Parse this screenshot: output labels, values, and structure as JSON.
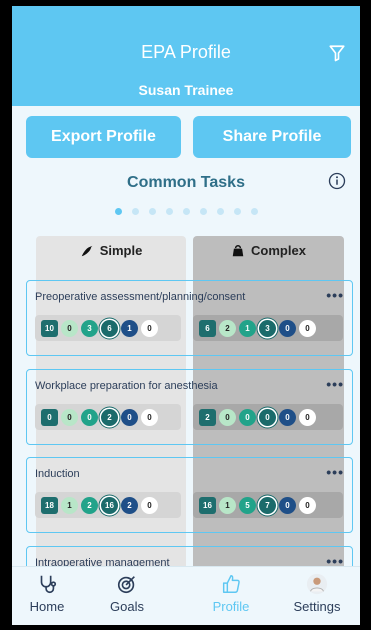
{
  "header": {
    "title": "EPA Profile",
    "user_name": "Susan Trainee"
  },
  "actions": {
    "export_label": "Export Profile",
    "share_label": "Share Profile"
  },
  "section_title": "Common Tasks",
  "pager": {
    "count": 9,
    "active_index": 0
  },
  "tabs": {
    "simple_label": "Simple",
    "complex_label": "Complex"
  },
  "cards": [
    {
      "title": "Preoperative assessment/planning/consent",
      "simple": [
        "10",
        "0",
        "3",
        "6",
        "1",
        "0"
      ],
      "complex": [
        "6",
        "2",
        "1",
        "3",
        "0",
        "0"
      ]
    },
    {
      "title": "Workplace preparation for anesthesia",
      "simple": [
        "0",
        "0",
        "0",
        "2",
        "0",
        "0"
      ],
      "complex": [
        "2",
        "0",
        "0",
        "0",
        "0",
        "0"
      ]
    },
    {
      "title": "Induction",
      "simple": [
        "18",
        "1",
        "2",
        "16",
        "2",
        "0"
      ],
      "complex": [
        "16",
        "1",
        "5",
        "7",
        "0",
        "0"
      ]
    },
    {
      "title": "Intraoperative management",
      "simple": [],
      "complex": []
    }
  ],
  "more_label": "•••",
  "nav": [
    {
      "label": "Home",
      "icon": "stethoscope-icon"
    },
    {
      "label": "Goals",
      "icon": "target-icon"
    },
    {
      "label": "Profile",
      "icon": "thumbs-up-icon",
      "active": true
    },
    {
      "label": "Settings",
      "icon": "avatar-icon"
    }
  ],
  "colors": {
    "primary": "#5ec7f2",
    "background": "#eef7fc",
    "text": "#2c3e5a"
  }
}
